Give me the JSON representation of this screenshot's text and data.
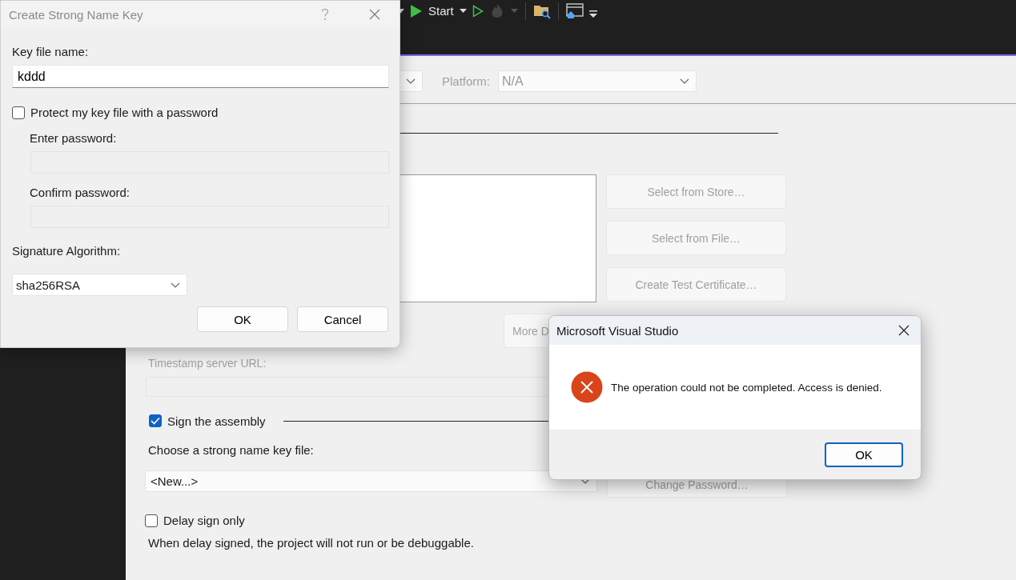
{
  "toolbar": {
    "start_label": "Start"
  },
  "properties": {
    "platform_label": "Platform:",
    "platform_value": "N/A",
    "cert_buttons": [
      {
        "label": "Select from Store…",
        "disabled": true
      },
      {
        "label": "Select from File…",
        "disabled": true
      },
      {
        "label": "Create Test Certificate…",
        "disabled": true
      }
    ],
    "more_button": {
      "label": "More D",
      "disabled": true
    },
    "timestamp": {
      "label": "Timestamp server URL:",
      "disabled": true
    },
    "sign_assembly": {
      "label": "Sign the assembly",
      "checked": true
    },
    "key_file_label": "Choose a strong name key file:",
    "key_file_value": "<New...>",
    "change_password": {
      "label": "Change Password…",
      "disabled": true
    },
    "delay_sign": {
      "label": "Delay sign only",
      "checked": false
    },
    "note": "When delay signed, the project will not run or be debuggable."
  },
  "key_dialog": {
    "title": "Create Strong Name Key",
    "key_label": "Key file name:",
    "key_value": "kddd",
    "protect": {
      "label": "Protect my key file with a password",
      "checked": false
    },
    "password_fields": [
      {
        "label": "Enter password:",
        "disabled": true
      },
      {
        "label": "Confirm password:",
        "disabled": true
      }
    ],
    "algorithm_label": "Signature Algorithm:",
    "algorithm_value": "sha256RSA",
    "buttons": [
      {
        "label": "OK",
        "default": false
      },
      {
        "label": "Cancel",
        "default": false
      }
    ]
  },
  "message_box": {
    "title": "Microsoft Visual Studio",
    "kind": "error",
    "message": "The operation could not be completed. Access is denied.",
    "buttons": [
      {
        "label": "OK",
        "default": true
      }
    ]
  }
}
